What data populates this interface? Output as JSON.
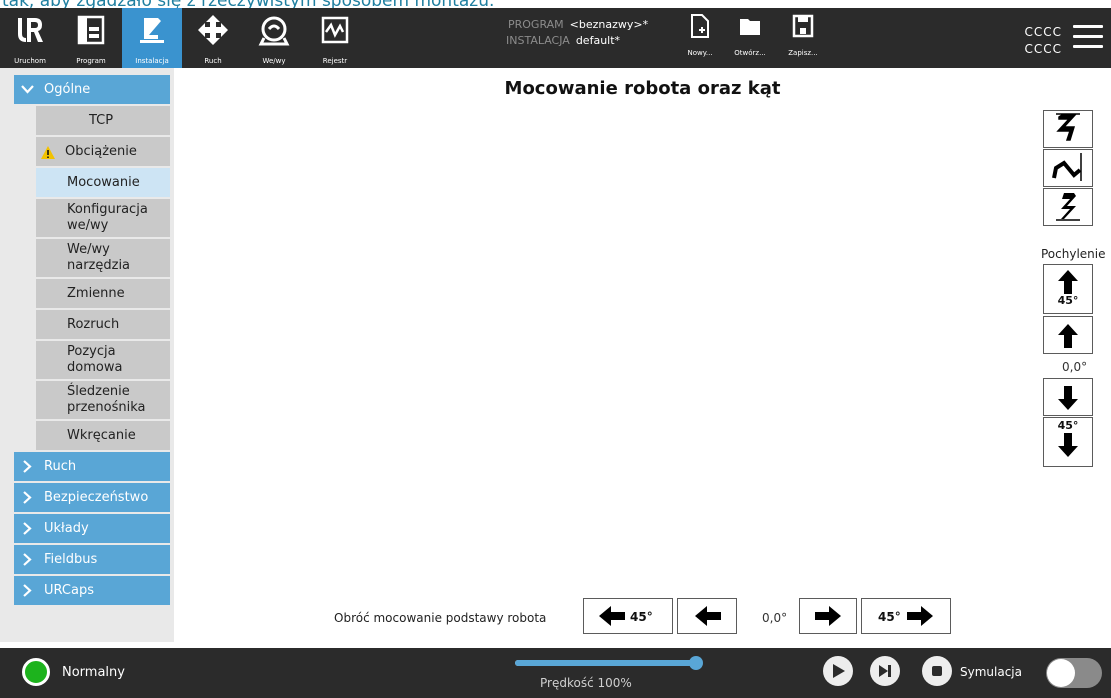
{
  "banner": {
    "text": "tak, aby zgadzało się z rzeczywistym sposobem montażu."
  },
  "toolbar": {
    "tabs": [
      {
        "label": "Uruchom"
      },
      {
        "label": "Program"
      },
      {
        "label": "Instalacja"
      },
      {
        "label": "Ruch"
      },
      {
        "label": "We/wy"
      },
      {
        "label": "Rejestr"
      }
    ],
    "program_label": "PROGRAM",
    "program_value": "<beznazwy>*",
    "installation_label": "INSTALACJA",
    "installation_value": "default*",
    "new_label": "Nowy...",
    "open_label": "Otwórz...",
    "save_label": "Zapisz...",
    "user_line1": "CCCC",
    "user_line2": "CCCC"
  },
  "sidebar": {
    "general_label": "Ogólne",
    "items": [
      {
        "label": "TCP"
      },
      {
        "label": "Obciążenie"
      },
      {
        "label": "Mocowanie"
      },
      {
        "label": "Konfiguracja we/wy"
      },
      {
        "label": "We/wy narzędzia"
      },
      {
        "label": "Zmienne"
      },
      {
        "label": "Rozruch"
      },
      {
        "label": "Pozycja domowa"
      },
      {
        "label": "Śledzenie przenośnika"
      },
      {
        "label": "Wkręcanie"
      }
    ],
    "groups": [
      {
        "label": "Ruch"
      },
      {
        "label": "Bezpieczeństwo"
      },
      {
        "label": "Układy"
      },
      {
        "label": "Fieldbus"
      },
      {
        "label": "URCaps"
      }
    ]
  },
  "main": {
    "title": "Mocowanie robota oraz kąt",
    "tilt_label": "Pochylenie",
    "tilt_value": "0,0°",
    "tilt_step": "45°",
    "rotate_label": "Obróć mocowanie podstawy robota",
    "rotate_value": "0,0°",
    "rotate_step": "45°"
  },
  "footer": {
    "status": "Normalny",
    "speed": "Prędkość 100%",
    "speed_fraction": 1.0,
    "simulation_label": "Symulacja"
  },
  "colors": {
    "accent": "#3a93cf",
    "sidebar_group": "#59a6d6",
    "status_ok": "#1db31d",
    "dark_bar": "#2b2b2b"
  }
}
